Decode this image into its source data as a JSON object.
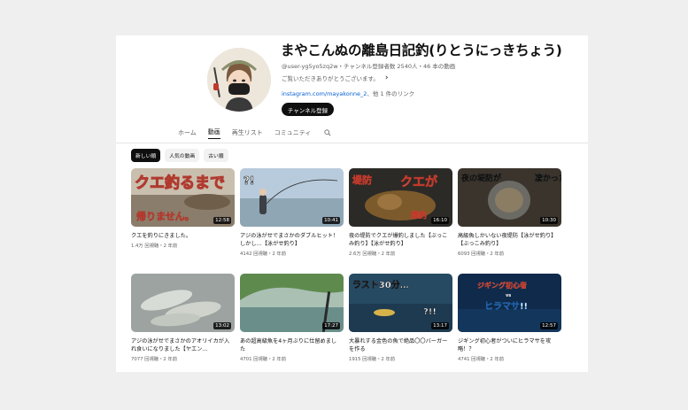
{
  "channel": {
    "name": "まやこんぬの離島日記釣(りとうにっきちょう)",
    "meta": "@user-yg5yo5zq2w・チャンネル登録者数 2540人・46 本の動画",
    "description": "ご覧いただきありがとうございます。",
    "link_text": "instagram.com/mayakonne_2",
    "link_suffix": "、他 1 件のリンク",
    "subscribe_label": "チャンネル登録"
  },
  "tabs": [
    "ホーム",
    "動画",
    "再生リスト",
    "コミュニティ"
  ],
  "active_tab": 1,
  "chips": [
    "新しい順",
    "人気の動画",
    "古い順"
  ],
  "active_chip": 0,
  "videos": [
    {
      "title": "クエを釣りにきました。",
      "views": "1.4万 回視聴",
      "age": "2 年前",
      "duration": "12:58",
      "overlay": [
        "クエ釣るまで",
        "帰りません。"
      ]
    },
    {
      "title": "アジの泳がせでまさかのダブルヒット！しかし…【泳がせ釣り】",
      "views": "4142 回視聴",
      "age": "2 年前",
      "duration": "10:41",
      "overlay": [
        "?!"
      ]
    },
    {
      "title": "夜の堤防でクエが爆釣しました【ぶっこみ釣り】【泳がせ釣り】",
      "views": "2.6万 回視聴",
      "age": "2 年前",
      "duration": "16:10",
      "overlay": [
        "堤防",
        "クエが",
        "爆釣"
      ]
    },
    {
      "title": "高級魚しかいない夜堤防【泳がせ釣り】【ぶっこみ釣り】",
      "views": "6093 回視聴",
      "age": "2 年前",
      "duration": "10:30",
      "overlay": [
        "夜の堤防が",
        "凄かった"
      ]
    },
    {
      "title": "アジの泳がせでまさかのアオリイカが入れ食いになりました【ヤエン…",
      "views": "7077 回視聴",
      "age": "2 年前",
      "duration": "13:02",
      "overlay": []
    },
    {
      "title": "あの超高級魚を4ヶ月ぶりに仕留めました",
      "views": "4701 回視聴",
      "age": "2 年前",
      "duration": "17:27",
      "overlay": []
    },
    {
      "title": "大暴れする金色の魚で絶品〇〇バーガーを作る",
      "views": "1915 回視聴",
      "age": "2 年前",
      "duration": "13:17",
      "overlay": [
        "ラスト30分…",
        "?!!"
      ]
    },
    {
      "title": "ジギング初心者がついにヒラマサを攻略！？",
      "views": "4741 回視聴",
      "age": "2 年前",
      "duration": "12:57",
      "overlay": [
        "ジギング初心者",
        "vs",
        "ヒラマサ!!"
      ]
    }
  ],
  "colors": {
    "accent_text": "#0f0f0f",
    "secondary_text": "#606060",
    "link": "#065fd4",
    "page_bg": "#efeff0"
  }
}
